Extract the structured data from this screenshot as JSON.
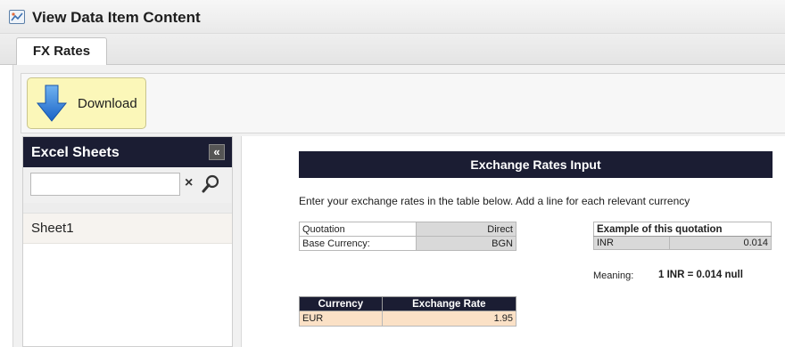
{
  "window": {
    "title": "View Data Item Content"
  },
  "tabs": [
    {
      "label": "FX Rates"
    }
  ],
  "toolbar": {
    "download_label": "Download"
  },
  "sidebar": {
    "title": "Excel Sheets",
    "collapse_glyph": "«",
    "search": {
      "value": "",
      "placeholder": ""
    },
    "clear_glyph": "×",
    "sheets": [
      {
        "label": "Sheet1"
      }
    ]
  },
  "panel": {
    "header": "Exchange Rates Input",
    "instruction": "Enter your exchange rates in the table below. Add a line for each relevant currency",
    "quotation": {
      "rows": [
        {
          "label": "Quotation",
          "value": "Direct"
        },
        {
          "label": "Base Currency:",
          "value": "BGN"
        }
      ]
    },
    "example": {
      "header": "Example of this quotation",
      "currency": "INR",
      "rate": "0.014",
      "meaning_label": "Meaning:",
      "meaning_value": "1 INR = 0.014 null"
    },
    "rates": {
      "columns": [
        "Currency",
        "Exchange Rate"
      ],
      "rows": [
        {
          "currency": "EUR",
          "rate": "1.95"
        }
      ]
    }
  },
  "colors": {
    "header_dark": "#1b1d33",
    "download_bg": "#fbf7b9",
    "input_row": "#fbe1c6",
    "readonly_cell": "#d9d9d9"
  }
}
